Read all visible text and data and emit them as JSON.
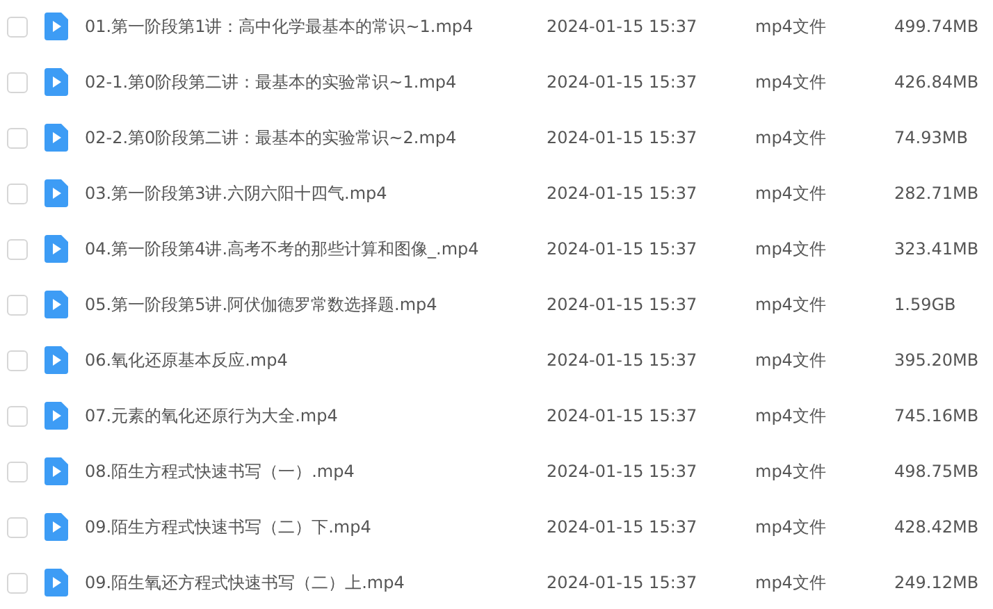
{
  "files": [
    {
      "name": "01.第一阶段第1讲：高中化学最基本的常识~1.mp4",
      "modified": "2024-01-15 15:37",
      "type": "mp4文件",
      "size": "499.74MB",
      "checked": false
    },
    {
      "name": "02-1.第0阶段第二讲：最基本的实验常识~1.mp4",
      "modified": "2024-01-15 15:37",
      "type": "mp4文件",
      "size": "426.84MB",
      "checked": false
    },
    {
      "name": "02-2.第0阶段第二讲：最基本的实验常识~2.mp4",
      "modified": "2024-01-15 15:37",
      "type": "mp4文件",
      "size": "74.93MB",
      "checked": false
    },
    {
      "name": "03.第一阶段第3讲.六阴六阳十四气.mp4",
      "modified": "2024-01-15 15:37",
      "type": "mp4文件",
      "size": "282.71MB",
      "checked": false
    },
    {
      "name": "04.第一阶段第4讲.高考不考的那些计算和图像_.mp4",
      "modified": "2024-01-15 15:37",
      "type": "mp4文件",
      "size": "323.41MB",
      "checked": false
    },
    {
      "name": "05.第一阶段第5讲.阿伏伽德罗常数选择题.mp4",
      "modified": "2024-01-15 15:37",
      "type": "mp4文件",
      "size": "1.59GB",
      "checked": false
    },
    {
      "name": "06.氧化还原基本反应.mp4",
      "modified": "2024-01-15 15:37",
      "type": "mp4文件",
      "size": "395.20MB",
      "checked": false
    },
    {
      "name": "07.元素的氧化还原行为大全.mp4",
      "modified": "2024-01-15 15:37",
      "type": "mp4文件",
      "size": "745.16MB",
      "checked": false
    },
    {
      "name": "08.陌生方程式快速书写（一）.mp4",
      "modified": "2024-01-15 15:37",
      "type": "mp4文件",
      "size": "498.75MB",
      "checked": false
    },
    {
      "name": "09.陌生方程式快速书写（二）下.mp4",
      "modified": "2024-01-15 15:37",
      "type": "mp4文件",
      "size": "428.42MB",
      "checked": false
    },
    {
      "name": "09.陌生氧还方程式快速书写（二）上.mp4",
      "modified": "2024-01-15 15:37",
      "type": "mp4文件",
      "size": "249.12MB",
      "checked": false
    }
  ]
}
